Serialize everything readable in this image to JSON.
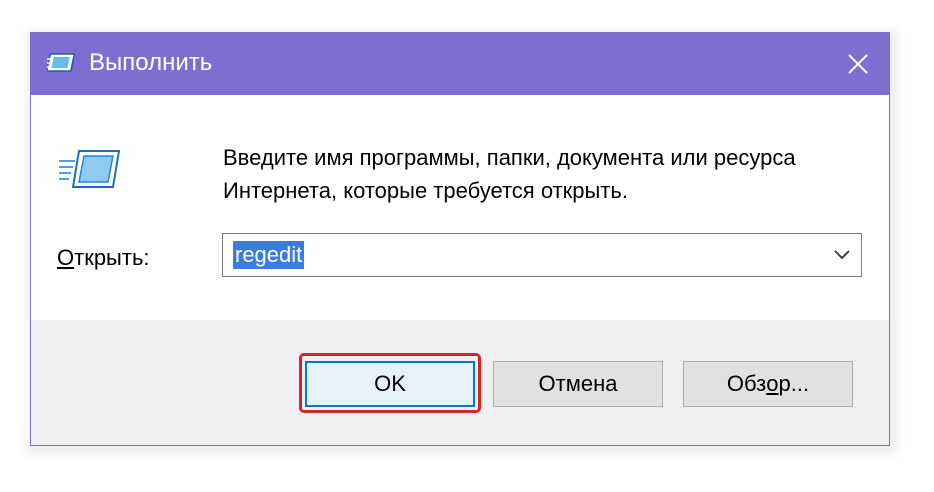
{
  "window": {
    "title": "Выполнить",
    "close_glyph": "✕"
  },
  "dialog": {
    "description": "Введите имя программы, папки, документа или ресурса Интернета, которые требуется открыть.",
    "open_label_mnemonic": "О",
    "open_label_rest": "ткрыть:",
    "open_value": "regedit"
  },
  "buttons": {
    "ok": "OK",
    "cancel": "Отмена",
    "browse_before": "Обз",
    "browse_mnemonic": "о",
    "browse_after": "р..."
  },
  "colors": {
    "titlebar": "#7d6ed0",
    "selection": "#3b7ddd",
    "highlight": "#d8232a"
  },
  "icons": [
    "run-app-icon",
    "close-icon",
    "run-dialog-icon",
    "chevron-down-icon"
  ]
}
